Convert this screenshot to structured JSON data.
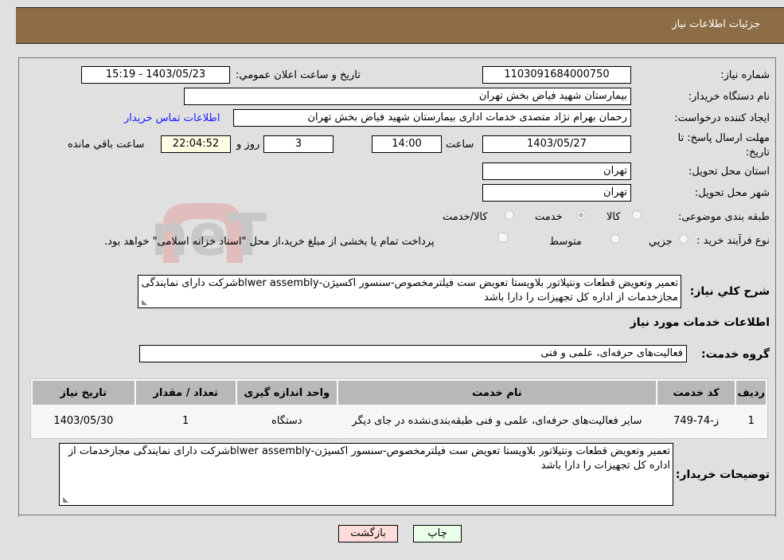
{
  "header": {
    "title": "جزئیات اطلاعات نیاز"
  },
  "form": {
    "need_number_label": "شماره نیاز:",
    "need_number": "1103091684000750",
    "announce_label": "تاریخ و ساعت اعلان عمومي:",
    "announce_value": "1403/05/23 - 15:19",
    "buyer_org_label": "نام دستگاه خریدار:",
    "buyer_org": "بیمارستان شهید فیاض بخش تهران",
    "requester_label": "ایجاد کننده درخواست:",
    "requester": "رحمان بهرام نژاد متصدی خدمات اداری بیمارستان شهید فیاض بخش تهران",
    "buyer_contact_link": "اطلاعات تماس خریدار",
    "deadline_label": "مهلت ارسال پاسخ: تا تاریخ:",
    "deadline_date": "1403/05/27",
    "time_label": "ساعت",
    "deadline_time": "14:00",
    "days_value": "3",
    "days_label": "روز و",
    "remaining_time": "22:04:52",
    "remaining_label": "ساعت باقي مانده",
    "province_label": "استان محل تحویل:",
    "province": "تهران",
    "city_label": "شهر محل تحویل:",
    "city": "تهران",
    "category_label": "طبقه بندی موضوعی:",
    "category_options": [
      "کالا",
      "خدمت",
      "کالا/خدمت"
    ],
    "category_selected": "خدمت",
    "process_label": "نوع فرآیند خرید :",
    "process_options": [
      "جزيي",
      "متوسط"
    ],
    "payment_note": "پرداخت تمام یا بخشی از مبلغ خرید،از محل \"اسناد خزانه اسلامی\" خواهد بود.",
    "general_desc_label": "شرح کلي نیاز:",
    "general_desc": "تعمیر وتعویض قطعات ونتیلاتور بلاویستا تعویض ست فیلترمخصوص-سنسور اکسیژن-blwer assemblyشرکت دارای نمایندگی مجازخدمات از اداره کل تجهیزات را دارا باشد",
    "services_section_title": "اطلاعات خدمات مورد نیاز",
    "service_group_label": "گروه خدمت:",
    "service_group": "فعالیت‌های حرفه‌ای، علمی و فنی"
  },
  "table": {
    "headers": [
      "ردیف",
      "کد خدمت",
      "نام خدمت",
      "واحد اندازه گیری",
      "تعداد / مقدار",
      "تاریخ نیاز"
    ],
    "rows": [
      [
        "1",
        "ز-74-749",
        "سایر فعالیت‌های حرفه‌ای، علمی و فنی طبقه‌بندی‌نشده در جای دیگر",
        "دستگاه",
        "1",
        "1403/05/30"
      ]
    ]
  },
  "buyer_notes": {
    "label": "توضیحات خریدار:",
    "text": "تعمیر وتعویض قطعات ونتیلاتور بلاویستا تعویض ست فیلترمخصوص-سنسور اکسیژن-blwer assemblyشرکت دارای نمایندگی مجازخدمات از اداره کل تجهیزات را دارا باشد"
  },
  "buttons": {
    "print": "چاپ",
    "back": "بازگشت"
  },
  "colors": {
    "header_bg": "#8c6d45",
    "print_bg": "#eaffea",
    "back_bg": "#ffdcdc",
    "remaining_bg": "#ffffe6",
    "link": "#1a1aff"
  }
}
